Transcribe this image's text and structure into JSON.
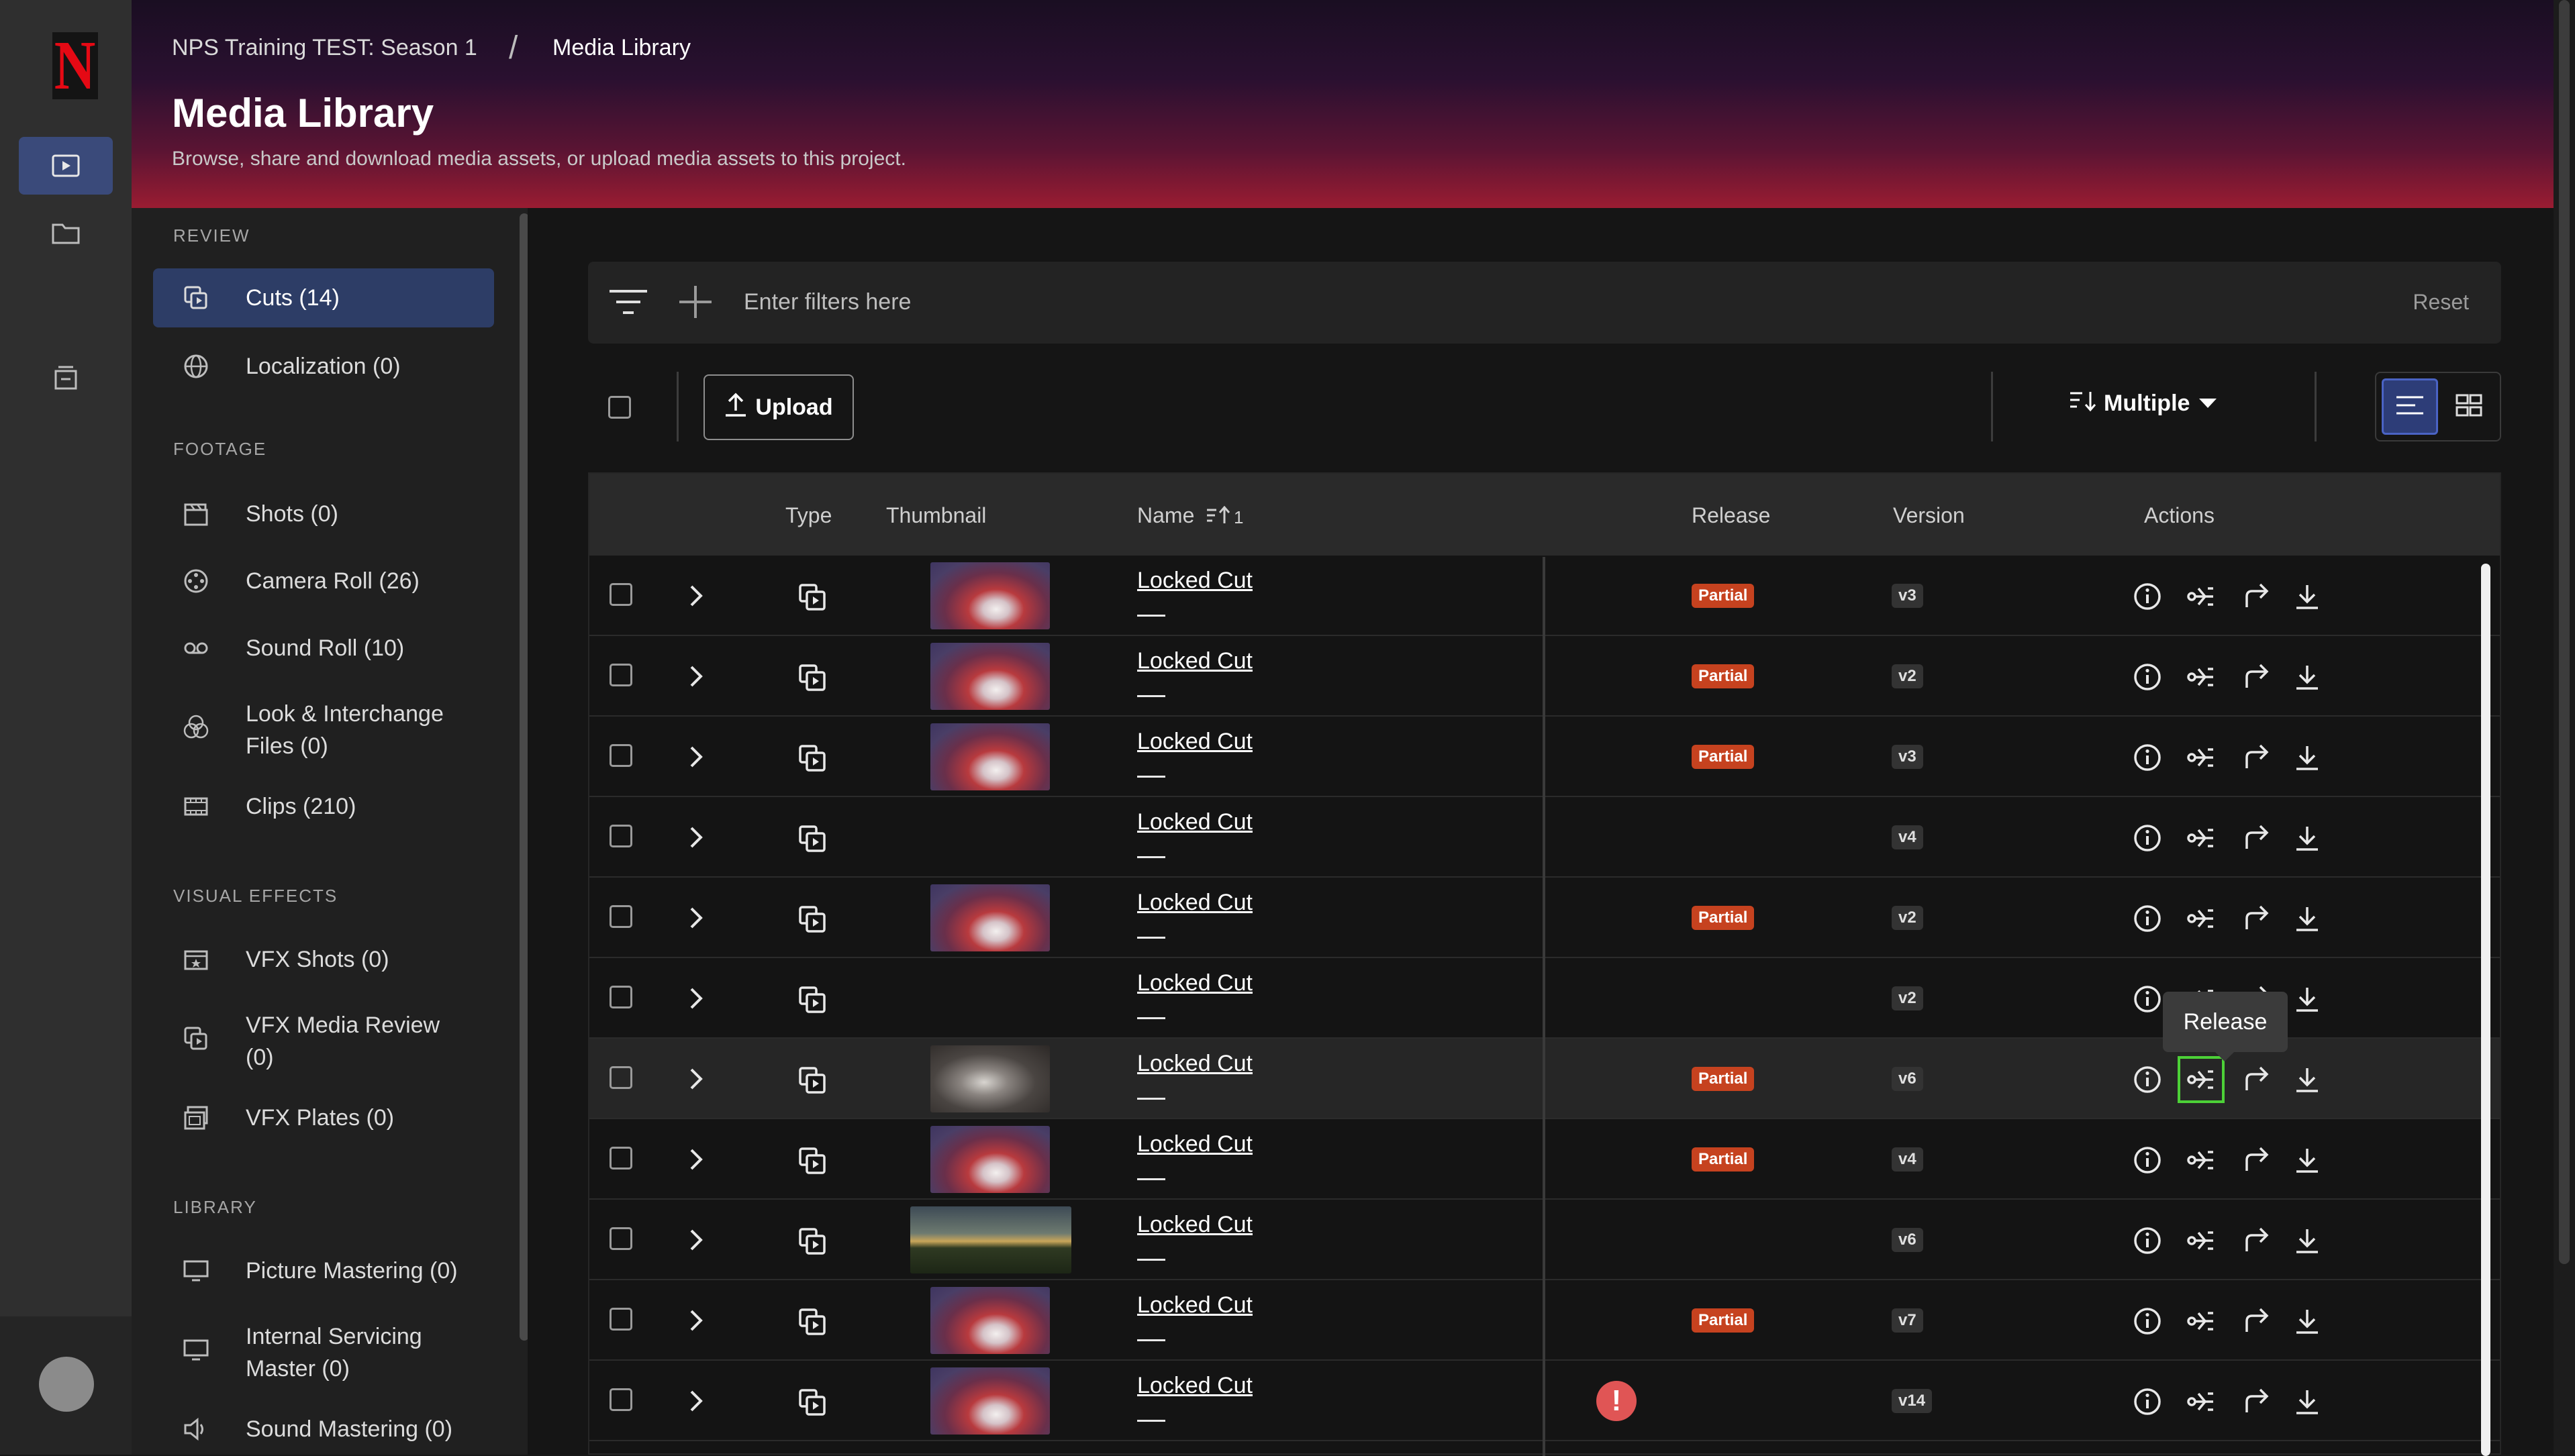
{
  "app": {
    "logo_letter": "N",
    "brand_color": "#e50914"
  },
  "header": {
    "breadcrumb": [
      "NPS Training TEST: Season 1",
      "Media Library"
    ],
    "breadcrumb_sep": "/",
    "title": "Media Library",
    "subtitle": "Browse, share and download media assets, or upload media assets to this project."
  },
  "sidebar": {
    "sections": [
      {
        "label": "REVIEW",
        "items": [
          {
            "label": "Cuts (14)",
            "icon": "cuts-icon",
            "active": true
          },
          {
            "label": "Localization (0)",
            "icon": "globe-icon"
          }
        ]
      },
      {
        "label": "FOOTAGE",
        "items": [
          {
            "label": "Shots (0)",
            "icon": "clapperboard-icon"
          },
          {
            "label": "Camera Roll (26)",
            "icon": "camera-roll-icon"
          },
          {
            "label": "Sound Roll (10)",
            "icon": "sound-roll-icon"
          },
          {
            "label": "Look & Interchange Files (0)",
            "icon": "look-icon"
          },
          {
            "label": "Clips (210)",
            "icon": "film-strip-icon"
          }
        ]
      },
      {
        "label": "VISUAL EFFECTS",
        "items": [
          {
            "label": "VFX Shots (0)",
            "icon": "vfx-shots-icon"
          },
          {
            "label": "VFX Media Review (0)",
            "icon": "vfx-review-icon"
          },
          {
            "label": "VFX Plates (0)",
            "icon": "vfx-plates-icon"
          }
        ]
      },
      {
        "label": "LIBRARY",
        "items": [
          {
            "label": "Picture Mastering (0)",
            "icon": "monitor-icon"
          },
          {
            "label": "Internal Servicing Master (0)",
            "icon": "monitor-icon"
          },
          {
            "label": "Sound Mastering (0)",
            "icon": "speaker-icon"
          }
        ]
      }
    ]
  },
  "filters": {
    "placeholder": "Enter filters here",
    "reset_label": "Reset"
  },
  "toolbar": {
    "upload_label": "Upload",
    "sort_label": "Multiple"
  },
  "table": {
    "columns": {
      "type": "Type",
      "thumbnail": "Thumbnail",
      "name": "Name",
      "name_sort": "1",
      "release": "Release",
      "version": "Version",
      "actions": "Actions"
    },
    "rows": [
      {
        "name": "Locked Cut",
        "sub": "—",
        "thumb": "fire",
        "release": "Partial",
        "version": "v3"
      },
      {
        "name": "Locked Cut",
        "sub": "—",
        "thumb": "fire",
        "release": "Partial",
        "version": "v2"
      },
      {
        "name": "Locked Cut",
        "sub": "—",
        "thumb": "fire",
        "release": "Partial",
        "version": "v3"
      },
      {
        "name": "Locked Cut",
        "sub": "—",
        "thumb": "",
        "release": "",
        "version": "v4"
      },
      {
        "name": "Locked Cut",
        "sub": "—",
        "thumb": "fire",
        "release": "Partial",
        "version": "v2"
      },
      {
        "name": "Locked Cut",
        "sub": "—",
        "thumb": "",
        "release": "",
        "version": "v2"
      },
      {
        "name": "Locked Cut",
        "sub": "—",
        "thumb": "person",
        "release": "Partial",
        "version": "v6"
      },
      {
        "name": "Locked Cut",
        "sub": "—",
        "thumb": "fire",
        "release": "Partial",
        "version": "v4"
      },
      {
        "name": "Locked Cut",
        "sub": "—",
        "thumb": "landscape",
        "release": "",
        "version": "v6"
      },
      {
        "name": "Locked Cut",
        "sub": "—",
        "thumb": "fire",
        "release": "Partial",
        "version": "v7"
      },
      {
        "name": "Locked Cut",
        "sub": "—",
        "thumb": "fire",
        "release": "",
        "version": "v14",
        "error": "!"
      }
    ]
  },
  "tooltip": {
    "label": "Release"
  }
}
